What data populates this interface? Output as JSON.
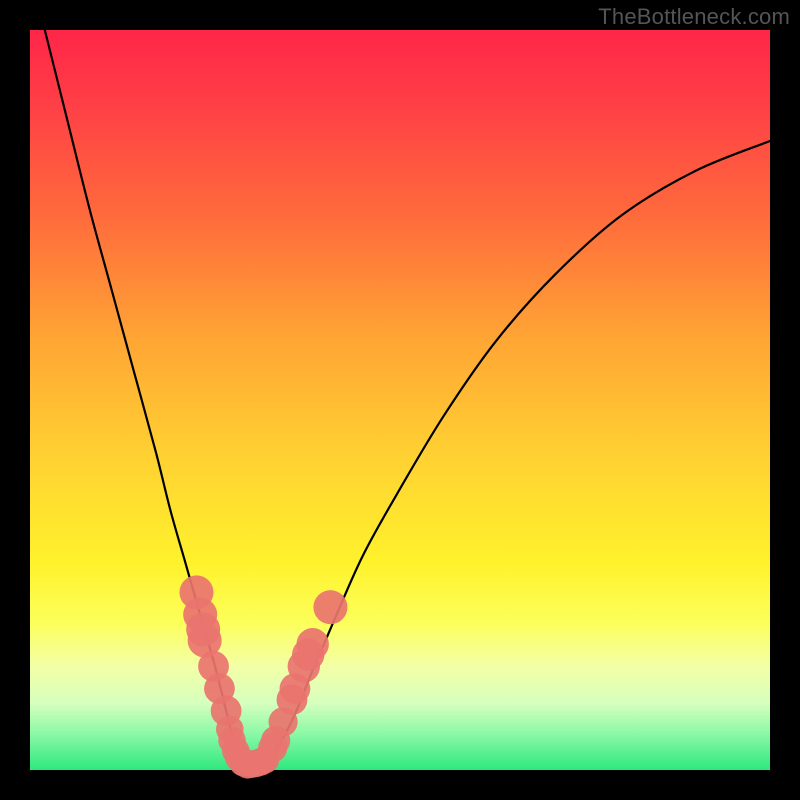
{
  "watermark": "TheBottleneck.com",
  "chart_data": {
    "type": "line",
    "title": "",
    "xlabel": "",
    "ylabel": "",
    "xlim": [
      0,
      100
    ],
    "ylim": [
      0,
      100
    ],
    "grid": false,
    "legend": false,
    "series": [
      {
        "name": "bottleneck-curve",
        "color": "#000000",
        "x": [
          2,
          5,
          8,
          11,
          14,
          17,
          19,
          21,
          23,
          25,
          26.5,
          27.5,
          28.5,
          30,
          32,
          34,
          36,
          38,
          41,
          45,
          50,
          56,
          63,
          71,
          80,
          90,
          100
        ],
        "y": [
          100,
          88,
          76,
          65,
          54,
          43,
          35,
          28,
          21,
          14,
          8,
          4,
          1.5,
          0.8,
          1.5,
          4,
          8,
          13,
          20,
          29,
          38,
          48,
          58,
          67,
          75,
          81,
          85
        ]
      }
    ],
    "scatter": {
      "name": "sample-points",
      "color": "#e9746f",
      "points": [
        {
          "x": 22.5,
          "y": 24.0,
          "r": 1.6
        },
        {
          "x": 23.0,
          "y": 21.0,
          "r": 1.6
        },
        {
          "x": 23.4,
          "y": 19.0,
          "r": 1.6
        },
        {
          "x": 23.6,
          "y": 17.5,
          "r": 1.6
        },
        {
          "x": 24.8,
          "y": 14.0,
          "r": 1.4
        },
        {
          "x": 25.6,
          "y": 11.0,
          "r": 1.4
        },
        {
          "x": 26.5,
          "y": 8.0,
          "r": 1.4
        },
        {
          "x": 27.0,
          "y": 5.5,
          "r": 1.2
        },
        {
          "x": 27.3,
          "y": 4.0,
          "r": 1.2
        },
        {
          "x": 27.8,
          "y": 2.6,
          "r": 1.2
        },
        {
          "x": 28.2,
          "y": 1.7,
          "r": 1.2
        },
        {
          "x": 28.8,
          "y": 1.0,
          "r": 1.2
        },
        {
          "x": 29.4,
          "y": 0.7,
          "r": 1.2
        },
        {
          "x": 30.0,
          "y": 0.8,
          "r": 1.2
        },
        {
          "x": 30.6,
          "y": 0.9,
          "r": 1.2
        },
        {
          "x": 31.2,
          "y": 1.1,
          "r": 1.2
        },
        {
          "x": 31.8,
          "y": 1.4,
          "r": 1.2
        },
        {
          "x": 32.8,
          "y": 3.0,
          "r": 1.3
        },
        {
          "x": 33.2,
          "y": 4.0,
          "r": 1.3
        },
        {
          "x": 34.2,
          "y": 6.5,
          "r": 1.3
        },
        {
          "x": 35.4,
          "y": 9.5,
          "r": 1.4
        },
        {
          "x": 35.8,
          "y": 11.0,
          "r": 1.4
        },
        {
          "x": 37.0,
          "y": 14.0,
          "r": 1.5
        },
        {
          "x": 37.6,
          "y": 15.6,
          "r": 1.5
        },
        {
          "x": 38.2,
          "y": 17.0,
          "r": 1.5
        },
        {
          "x": 40.6,
          "y": 22.0,
          "r": 1.6
        }
      ]
    }
  }
}
